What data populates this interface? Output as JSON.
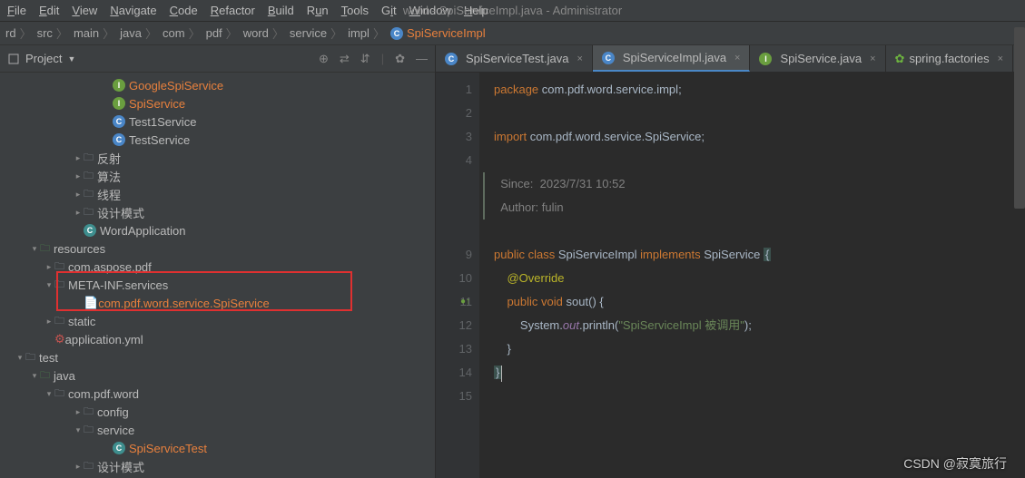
{
  "window": {
    "title": "word - SpiServiceImpl.java - Administrator"
  },
  "menu": [
    "File",
    "Edit",
    "View",
    "Navigate",
    "Code",
    "Refactor",
    "Build",
    "Run",
    "Tools",
    "Git",
    "Window",
    "Help"
  ],
  "breadcrumbs": [
    "rd",
    "src",
    "main",
    "java",
    "com",
    "pdf",
    "word",
    "service",
    "impl",
    "SpiServiceImpl"
  ],
  "project_panel": {
    "title": "Project"
  },
  "tree": [
    {
      "indent": 7,
      "icon": "interface",
      "label": "GoogleSpiService",
      "hl": true
    },
    {
      "indent": 7,
      "icon": "interface",
      "label": "SpiService",
      "hl": true
    },
    {
      "indent": 7,
      "icon": "class",
      "label": "Test1Service"
    },
    {
      "indent": 7,
      "icon": "class",
      "label": "TestService"
    },
    {
      "indent": 5,
      "arrow": ">",
      "icon": "folder",
      "label": "反射"
    },
    {
      "indent": 5,
      "arrow": ">",
      "icon": "folder",
      "label": "算法"
    },
    {
      "indent": 5,
      "arrow": ">",
      "icon": "folder",
      "label": "线程"
    },
    {
      "indent": 5,
      "arrow": ">",
      "icon": "folder",
      "label": "设计模式"
    },
    {
      "indent": 5,
      "icon": "kclass",
      "label": "WordApplication"
    },
    {
      "indent": 2,
      "arrow": "v",
      "icon": "resfolder",
      "label": "resources"
    },
    {
      "indent": 3,
      "arrow": ">",
      "icon": "folder",
      "label": "com.aspose.pdf"
    },
    {
      "indent": 3,
      "arrow": "v",
      "icon": "folder",
      "label": "META-INF.services"
    },
    {
      "indent": 5,
      "icon": "file",
      "label": "com.pdf.word.service.SpiService",
      "hl": true
    },
    {
      "indent": 3,
      "arrow": ">",
      "icon": "folder",
      "label": "static"
    },
    {
      "indent": 3,
      "icon": "yml",
      "label": "application.yml"
    },
    {
      "indent": 1,
      "arrow": "v",
      "icon": "folder",
      "label": "test"
    },
    {
      "indent": 2,
      "arrow": "v",
      "icon": "resfolder",
      "label": "java"
    },
    {
      "indent": 3,
      "arrow": "v",
      "icon": "folder",
      "label": "com.pdf.word"
    },
    {
      "indent": 5,
      "arrow": ">",
      "icon": "folder",
      "label": "config"
    },
    {
      "indent": 5,
      "arrow": "v",
      "icon": "folder",
      "label": "service"
    },
    {
      "indent": 7,
      "icon": "kclass",
      "label": "SpiServiceTest",
      "hl": true
    },
    {
      "indent": 5,
      "arrow": ">",
      "icon": "folder",
      "label": "设计模式"
    }
  ],
  "tabs": [
    {
      "icon": "class",
      "label": "SpiServiceTest.java",
      "active": false
    },
    {
      "icon": "class",
      "label": "SpiServiceImpl.java",
      "active": true
    },
    {
      "icon": "interface",
      "label": "SpiService.java",
      "active": false
    },
    {
      "icon": "spring",
      "label": "spring.factories",
      "active": false
    }
  ],
  "code": {
    "lines": [
      1,
      2,
      3,
      4,
      "",
      "",
      "",
      9,
      10,
      11,
      12,
      13,
      14,
      15
    ],
    "l1": {
      "kw": "package",
      "pkg": "com.pdf.word.service.impl",
      ";": ";"
    },
    "l3": {
      "kw": "import",
      "pkg": "com.pdf.word.service.SpiService",
      ";": ";"
    },
    "doc": {
      "since_lbl": "Since:",
      "since": "2023/7/31 10:52",
      "author_lbl": "Author:",
      "author": "fulin"
    },
    "l9": {
      "kw_public": "public",
      "kw_class": "class",
      "name": "SpiServiceImpl",
      "kw_impl": "implements",
      "iface": "SpiService"
    },
    "l10": {
      "ann": "@Override"
    },
    "l11": {
      "kw_public": "public",
      "kw_void": "void",
      "name": "sout",
      "paren": "() {"
    },
    "l12": {
      "sys": "System.",
      "out": "out",
      "call": ".println(",
      "str": "\"SpiServiceImpl 被调用\"",
      "end": ");"
    },
    "l13": {
      "brace": "}"
    },
    "l14": {
      "brace": "}"
    }
  },
  "watermark": "CSDN @寂寞旅行"
}
